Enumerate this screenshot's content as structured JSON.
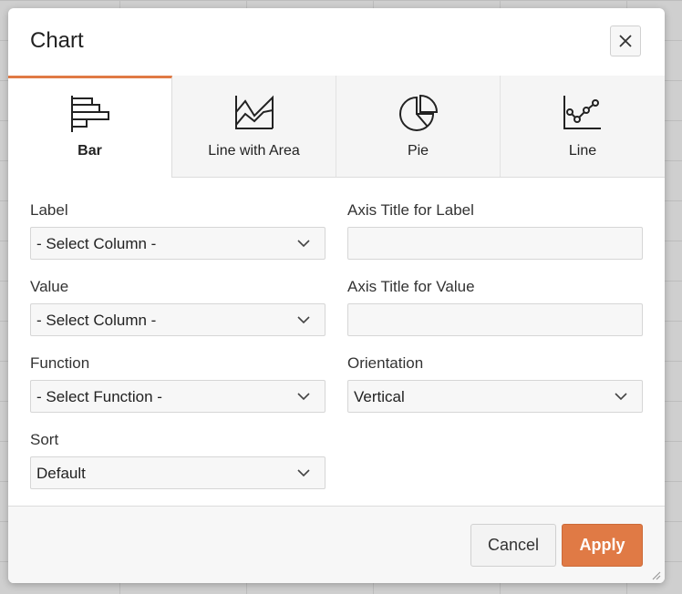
{
  "dialog": {
    "title": "Chart",
    "close_icon": "close-icon"
  },
  "tabs": [
    {
      "label": "Bar",
      "icon": "bar-chart-icon",
      "active": true
    },
    {
      "label": "Line with Area",
      "icon": "area-chart-icon",
      "active": false
    },
    {
      "label": "Pie",
      "icon": "pie-chart-icon",
      "active": false
    },
    {
      "label": "Line",
      "icon": "line-chart-icon",
      "active": false
    }
  ],
  "form": {
    "label": {
      "label": "Label",
      "value": "- Select Column -"
    },
    "value": {
      "label": "Value",
      "value": "- Select Column -"
    },
    "function": {
      "label": "Function",
      "value": "- Select Function -"
    },
    "sort": {
      "label": "Sort",
      "value": "Default"
    },
    "axis_title_label": {
      "label": "Axis Title for Label",
      "value": ""
    },
    "axis_title_value": {
      "label": "Axis Title for Value",
      "value": ""
    },
    "orientation": {
      "label": "Orientation",
      "value": "Vertical"
    }
  },
  "footer": {
    "cancel_label": "Cancel",
    "apply_label": "Apply"
  },
  "colors": {
    "accent": "#e07a45"
  }
}
